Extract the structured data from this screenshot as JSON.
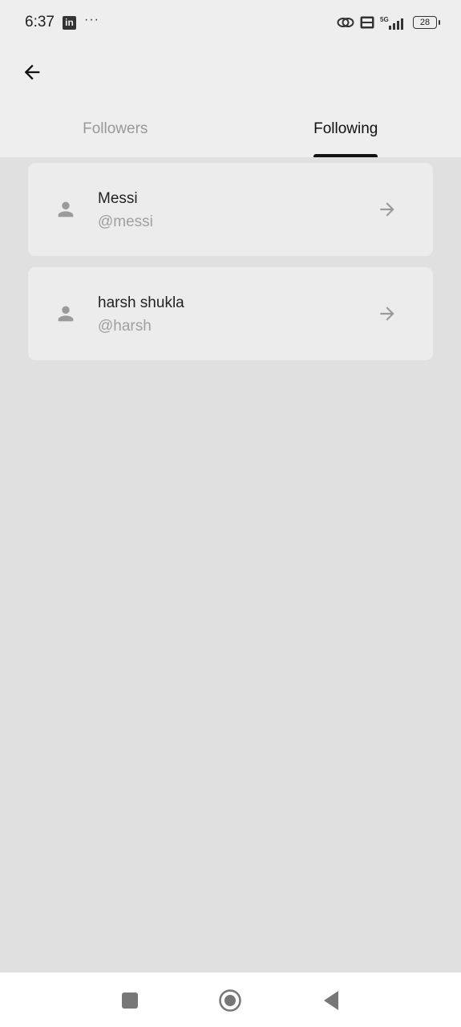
{
  "status_bar": {
    "time": "6:37",
    "linkedin_label": "in",
    "dots": "···",
    "network_label": "5G",
    "battery": "28"
  },
  "tabs": [
    {
      "label": "Followers",
      "active": false
    },
    {
      "label": "Following",
      "active": true
    }
  ],
  "following": [
    {
      "name": "Messi",
      "handle": "@messi"
    },
    {
      "name": "harsh shukla",
      "handle": "@harsh"
    }
  ],
  "colors": {
    "background": "#e0e0e0",
    "header": "#eeeeee",
    "card": "#ececec",
    "active_tab": "#111111",
    "inactive_tab": "#999999",
    "muted": "#a0a0a0"
  },
  "icons": {
    "back": "arrow-left-icon",
    "avatar": "person-icon",
    "row_action": "arrow-right-icon"
  }
}
